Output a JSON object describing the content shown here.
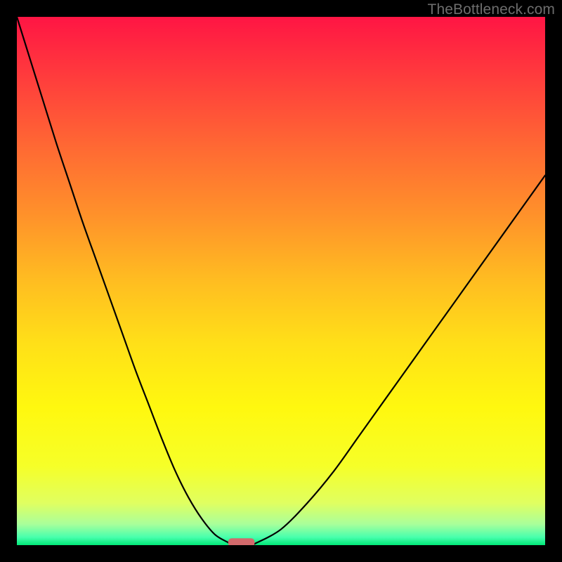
{
  "watermark": "TheBottleneck.com",
  "chart_data": {
    "type": "line",
    "title": "",
    "xlabel": "",
    "ylabel": "",
    "xlim": [
      0,
      100
    ],
    "ylim": [
      0,
      100
    ],
    "grid": false,
    "legend": false,
    "background_gradient_stops": [
      {
        "offset": 0.0,
        "color": "#ff1544"
      },
      {
        "offset": 0.12,
        "color": "#ff3e3c"
      },
      {
        "offset": 0.25,
        "color": "#ff6a33"
      },
      {
        "offset": 0.38,
        "color": "#ff932a"
      },
      {
        "offset": 0.5,
        "color": "#ffbd21"
      },
      {
        "offset": 0.62,
        "color": "#ffe018"
      },
      {
        "offset": 0.74,
        "color": "#fff80f"
      },
      {
        "offset": 0.85,
        "color": "#f6ff28"
      },
      {
        "offset": 0.92,
        "color": "#e0ff60"
      },
      {
        "offset": 0.96,
        "color": "#aaff9a"
      },
      {
        "offset": 0.985,
        "color": "#48ffad"
      },
      {
        "offset": 1.0,
        "color": "#00e878"
      }
    ],
    "series": [
      {
        "name": "bottleneck-curve",
        "color": "#000000",
        "x": [
          0.0,
          2.5,
          5.0,
          7.5,
          10.0,
          12.5,
          15.0,
          17.5,
          20.0,
          22.5,
          25.0,
          27.5,
          30.0,
          32.5,
          35.0,
          37.5,
          40.0,
          41.0,
          44.0,
          45.5,
          50.0,
          55.0,
          60.0,
          65.0,
          70.0,
          75.0,
          80.0,
          85.0,
          90.0,
          95.0,
          100.0
        ],
        "y": [
          100.0,
          92.0,
          84.0,
          76.0,
          68.5,
          61.0,
          54.0,
          47.0,
          40.0,
          33.0,
          26.5,
          20.0,
          14.0,
          9.0,
          5.0,
          2.0,
          0.5,
          0.0,
          0.0,
          0.5,
          3.0,
          8.0,
          14.0,
          21.0,
          28.0,
          35.0,
          42.0,
          49.0,
          56.0,
          63.0,
          70.0
        ]
      }
    ],
    "marker": {
      "name": "optimal-range-marker",
      "color": "#d36a6c",
      "x_center": 42.5,
      "y": 0.5,
      "width": 5.0,
      "height": 1.6
    }
  }
}
